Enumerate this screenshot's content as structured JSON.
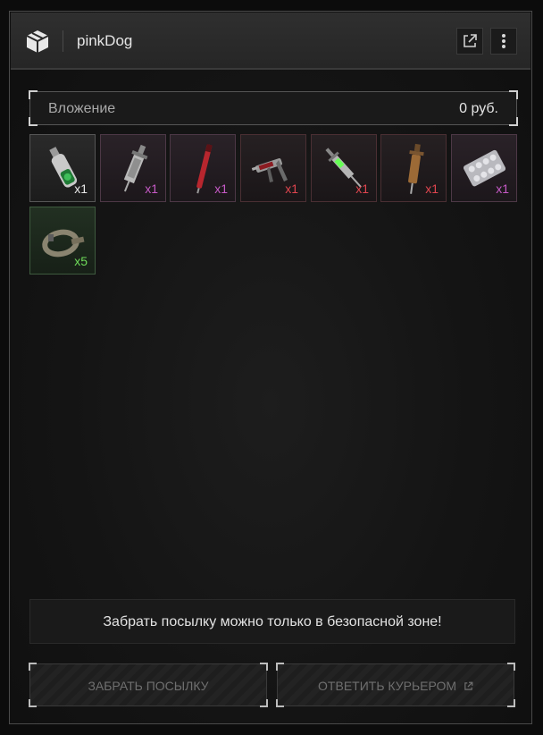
{
  "header": {
    "title": "pinkDog",
    "logo_icon": "package-box-icon",
    "external_icon": "external-link-icon",
    "menu_icon": "vertical-dots-icon"
  },
  "attachment": {
    "label": "Вложение",
    "value": "0  руб."
  },
  "items": [
    {
      "name": "green-bottle",
      "count": "x1",
      "count_color": "#e8e8e8",
      "rarity": "white"
    },
    {
      "name": "syringe-gray",
      "count": "x1",
      "count_color": "#c65ac6",
      "rarity": "purple"
    },
    {
      "name": "red-injector-pen",
      "count": "x1",
      "count_color": "#c65ac6",
      "rarity": "purple"
    },
    {
      "name": "injector-gun",
      "count": "x1",
      "count_color": "#e0454f",
      "rarity": "red"
    },
    {
      "name": "green-syringe",
      "count": "x1",
      "count_color": "#e0454f",
      "rarity": "red"
    },
    {
      "name": "brown-syringe",
      "count": "x1",
      "count_color": "#e0454f",
      "rarity": "red"
    },
    {
      "name": "pill-blister",
      "count": "x1",
      "count_color": "#c65ac6",
      "rarity": "purple"
    },
    {
      "name": "tourniquet-belt",
      "count": "x5",
      "count_color": "#6fdc5a",
      "rarity": "green"
    }
  ],
  "notice": "Забрать посылку можно только в безопасной зоне!",
  "buttons": {
    "take": "ЗАБРАТЬ ПОСЫЛКУ",
    "reply": "ОТВЕТИТЬ КУРЬЕРОМ",
    "reply_icon": "external-link-icon"
  }
}
